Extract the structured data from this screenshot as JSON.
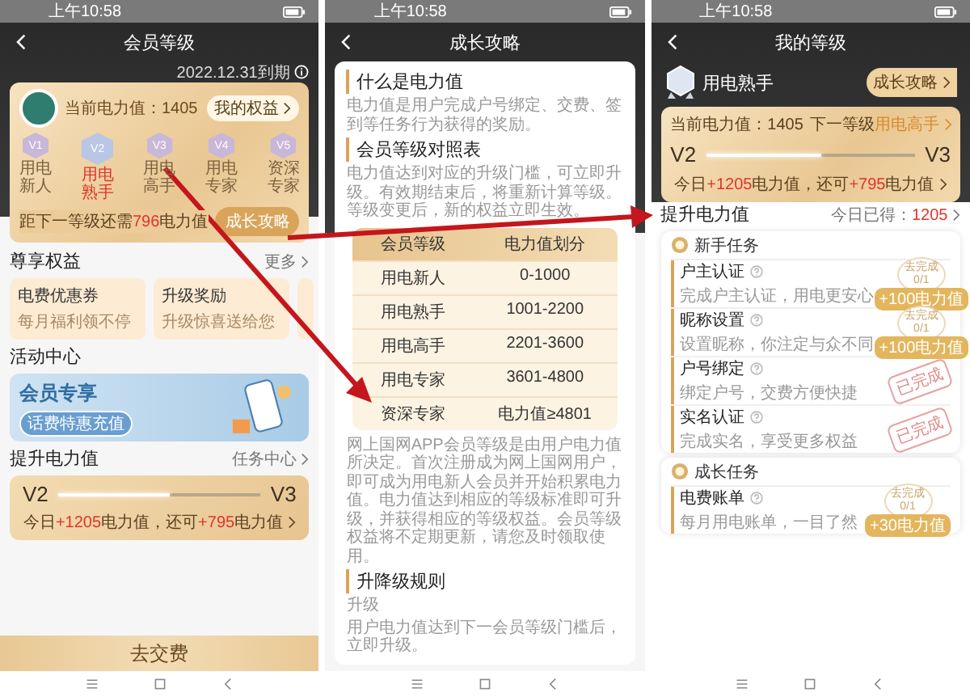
{
  "membership_screen": {
    "status_time": "上午10:58",
    "title": "会员等级",
    "expiry": "2022.12.31到期",
    "power_label": "当前电力值：1405",
    "rights_button": "我的权益",
    "levels": [
      {
        "badge": "V1",
        "name": "用电新人",
        "selected": false
      },
      {
        "badge": "V2",
        "name": "用电熟手",
        "selected": true
      },
      {
        "badge": "V3",
        "name": "用电高手",
        "selected": false
      },
      {
        "badge": "V4",
        "name": "用电专家",
        "selected": false
      },
      {
        "badge": "V5",
        "name": "资深专家",
        "selected": false
      }
    ],
    "next_level": [
      {
        "text": "距下一等级还需",
        "highlight": false
      },
      {
        "text": "796",
        "highlight": true
      },
      {
        "text": "电力值",
        "highlight": false
      }
    ],
    "guide_button": "成长攻略",
    "benefits": {
      "title": "尊享权益",
      "more": "更多",
      "cards": [
        {
          "title": "电费优惠券",
          "subtitle": "每月福利领不停"
        },
        {
          "title": "升级奖励",
          "subtitle": "升级惊喜送给您"
        }
      ]
    },
    "activity": {
      "title": "活动中心",
      "banner_title": "会员专享",
      "banner_button": "话费特惠充值"
    },
    "boost": {
      "title": "提升电力值",
      "link": "任务中心",
      "from": "V2",
      "to": "V3",
      "level": 0.55,
      "summary": [
        {
          "text": "今日",
          "highlight": false
        },
        {
          "text": "+1205",
          "highlight": true
        },
        {
          "text": "电力值，还可",
          "highlight": false
        },
        {
          "text": "+795",
          "highlight": true
        },
        {
          "text": "电力值",
          "highlight": false
        }
      ]
    },
    "pay_button": "去交费"
  },
  "guide_screen": {
    "status_time": "上午10:58",
    "title": "成长攻略",
    "sections": [
      {
        "title": "什么是电力值",
        "paragraph": "电力值是用户完成户号绑定、交费、签到等任务行为获得的奖励。"
      },
      {
        "title": "会员等级对照表",
        "paragraph": "电力值达到对应的升级门槛，可立即升级。有效期结束后，将重新计算等级。等级变更后，新的权益立即生效。"
      }
    ],
    "table": {
      "columns": [
        "会员等级",
        "电力值划分"
      ],
      "rows": [
        [
          "用电新人",
          "0-1000"
        ],
        [
          "用电熟手",
          "1001-2200"
        ],
        [
          "用电高手",
          "2201-3600"
        ],
        [
          "用电专家",
          "3601-4800"
        ],
        [
          "资深专家",
          "电力值≥4801"
        ]
      ]
    },
    "note": "网上国网APP会员等级是由用户电力值所决定。首次注册成为网上国网用户，即可成为用电新人会员并开始积累电力值。电力值达到相应的等级标准即可升级，并获得相应的等级权益。会员等级权益将不定期更新，请您及时领取使用。",
    "rules": {
      "title": "升降级规则",
      "subtitle": "升级",
      "text": "用户电力值达到下一会员等级门槛后，立即升级。"
    }
  },
  "my_level_screen": {
    "status_time": "上午10:58",
    "title": "我的等级",
    "level_name": "用电熟手",
    "guide_button": "成长攻略",
    "power_label": "当前电力值：1405",
    "next_label": "下一等级",
    "next_name": "用电高手",
    "from": "V2",
    "to": "V3",
    "level": 0.55,
    "summary": [
      {
        "text": "今日",
        "highlight": false
      },
      {
        "text": "+1205",
        "highlight": true
      },
      {
        "text": "电力值，还可",
        "highlight": false
      },
      {
        "text": "+795",
        "highlight": true
      },
      {
        "text": "电力值",
        "highlight": false
      }
    ],
    "boost_title": "提升电力值",
    "earned_label": "今日已得：",
    "earned_value": "1205",
    "groups": [
      {
        "title": "新手任务",
        "tasks": [
          {
            "name": "户主认证",
            "desc": "完成户主认证，用电更安心",
            "done": false,
            "action": "去完成",
            "progress": "0/1",
            "reward": "+100电力值"
          },
          {
            "name": "昵称设置",
            "desc": "设置昵称，你注定与众不同",
            "done": false,
            "action": "去完成",
            "progress": "0/1",
            "reward": "+100电力值"
          },
          {
            "name": "户号绑定",
            "desc": "绑定户号，交费方便快捷",
            "done": true,
            "stamp": "已完成"
          },
          {
            "name": "实名认证",
            "desc": "完成实名，享受更多权益",
            "done": true,
            "stamp": "已完成"
          }
        ]
      },
      {
        "title": "成长任务",
        "tasks": [
          {
            "name": "电费账单",
            "desc": "每月用电账单，一目了然",
            "done": false,
            "action": "去完成",
            "progress": "0/1",
            "reward": "+30电力值"
          }
        ]
      }
    ]
  }
}
